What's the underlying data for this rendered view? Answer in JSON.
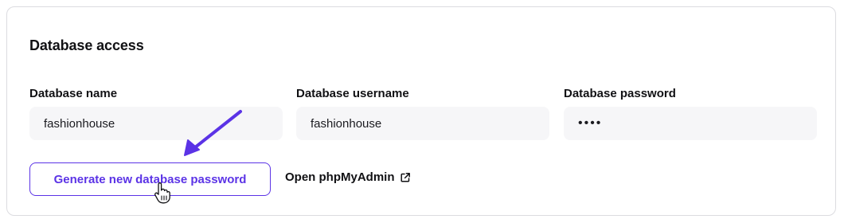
{
  "section": {
    "title": "Database access"
  },
  "fields": {
    "name": {
      "label": "Database name",
      "value": "fashionhouse"
    },
    "username": {
      "label": "Database username",
      "value": "fashionhouse"
    },
    "password": {
      "label": "Database password",
      "value": "••••"
    }
  },
  "actions": {
    "generate_label": "Generate new database password",
    "phpmyadmin_label": "Open phpMyAdmin"
  },
  "colors": {
    "accent": "#5b33e6",
    "field_bg": "#f6f6f8",
    "border": "#dcdce0"
  },
  "icons": {
    "external_link": "external-link-icon",
    "annotation": "arrow-annotation-icon",
    "cursor": "hand-pointer-icon"
  }
}
